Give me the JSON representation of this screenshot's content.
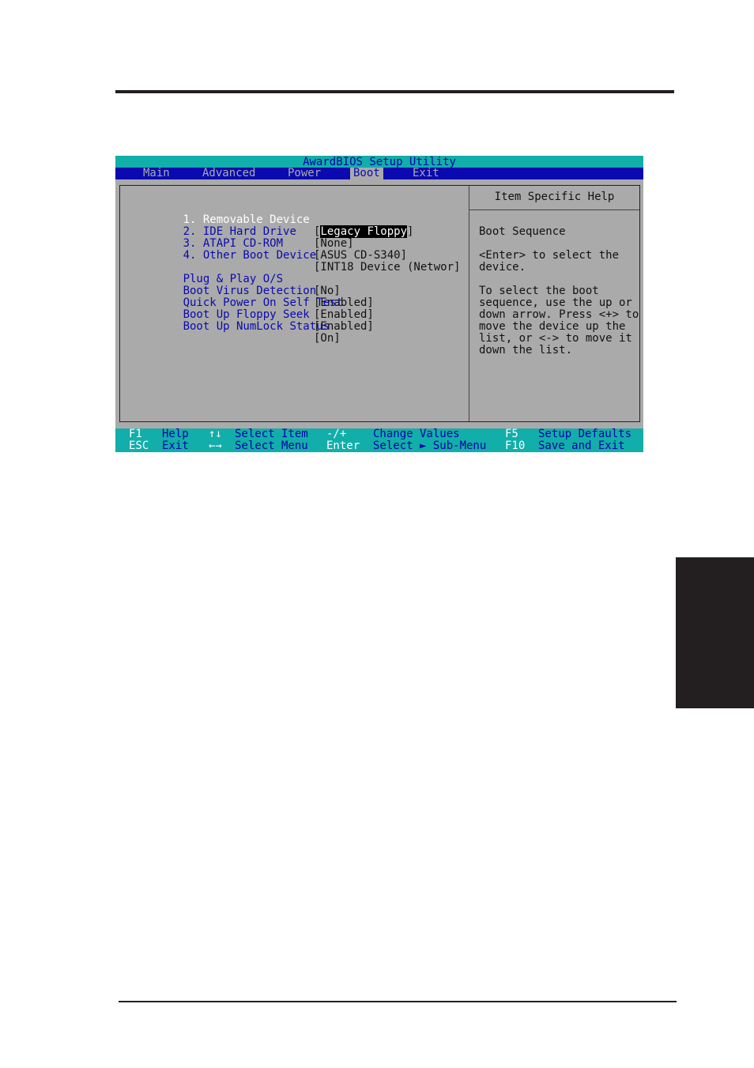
{
  "page": {
    "decorations": [
      "top-rule",
      "bottom-rule",
      "side-tab"
    ]
  },
  "bios": {
    "title": "AwardBIOS Setup Utility",
    "menu": [
      {
        "label": "Main",
        "active": false
      },
      {
        "label": "Advanced",
        "active": false
      },
      {
        "label": "Power",
        "active": false
      },
      {
        "label": "Boot",
        "active": true
      },
      {
        "label": "Exit",
        "active": false
      }
    ],
    "boot_devices": [
      {
        "label": "1. Removable Device",
        "value_prefix": "[",
        "value": "Legacy Floppy",
        "value_suffix": "]",
        "selected": true
      },
      {
        "label": "2. IDE Hard Drive",
        "value": "[None]"
      },
      {
        "label": "3. ATAPI CD-ROM",
        "value": "[ASUS CD-S340]"
      },
      {
        "label": "4. Other Boot Device",
        "value": "[INT18 Device (Networ]"
      }
    ],
    "settings": [
      {
        "label": "Plug & Play O/S",
        "value": "[No]"
      },
      {
        "label": "Boot Virus Detection",
        "value": "[Enabled]"
      },
      {
        "label": "Quick Power On Self Test",
        "value": "[Enabled]"
      },
      {
        "label": "Boot Up Floppy Seek",
        "value": "[Enabled]"
      },
      {
        "label": "Boot Up NumLock Status",
        "value": "[On]"
      }
    ],
    "help": {
      "title": "Item Specific Help",
      "lines": [
        "Boot Sequence",
        "<Enter> to select the",
        "device.",
        "To select the boot",
        "sequence, use the up or",
        "down arrow. Press <+> to",
        "move the device up the",
        "list, or <-> to move it",
        "down the list."
      ]
    },
    "status_bar": {
      "row1": [
        {
          "key": "F1",
          "action": "Help"
        },
        {
          "key": "↑↓",
          "action": "Select Item"
        },
        {
          "key": "-/+",
          "action": "Change Values"
        },
        {
          "key": "F5",
          "action": "Setup Defaults"
        }
      ],
      "row2": [
        {
          "key": "ESC",
          "action": "Exit"
        },
        {
          "key": "←→",
          "action": "Select Menu"
        },
        {
          "key": "Enter",
          "action": "Select ► Sub-Menu"
        },
        {
          "key": "F10",
          "action": "Save and Exit"
        }
      ]
    },
    "colors": {
      "title_bar": "#12aeaa",
      "menu_bar": "#0a0ab0",
      "panel": "#aaaaaa",
      "label_text": "#0a0ab0",
      "selected_text": "#ffffff"
    }
  }
}
